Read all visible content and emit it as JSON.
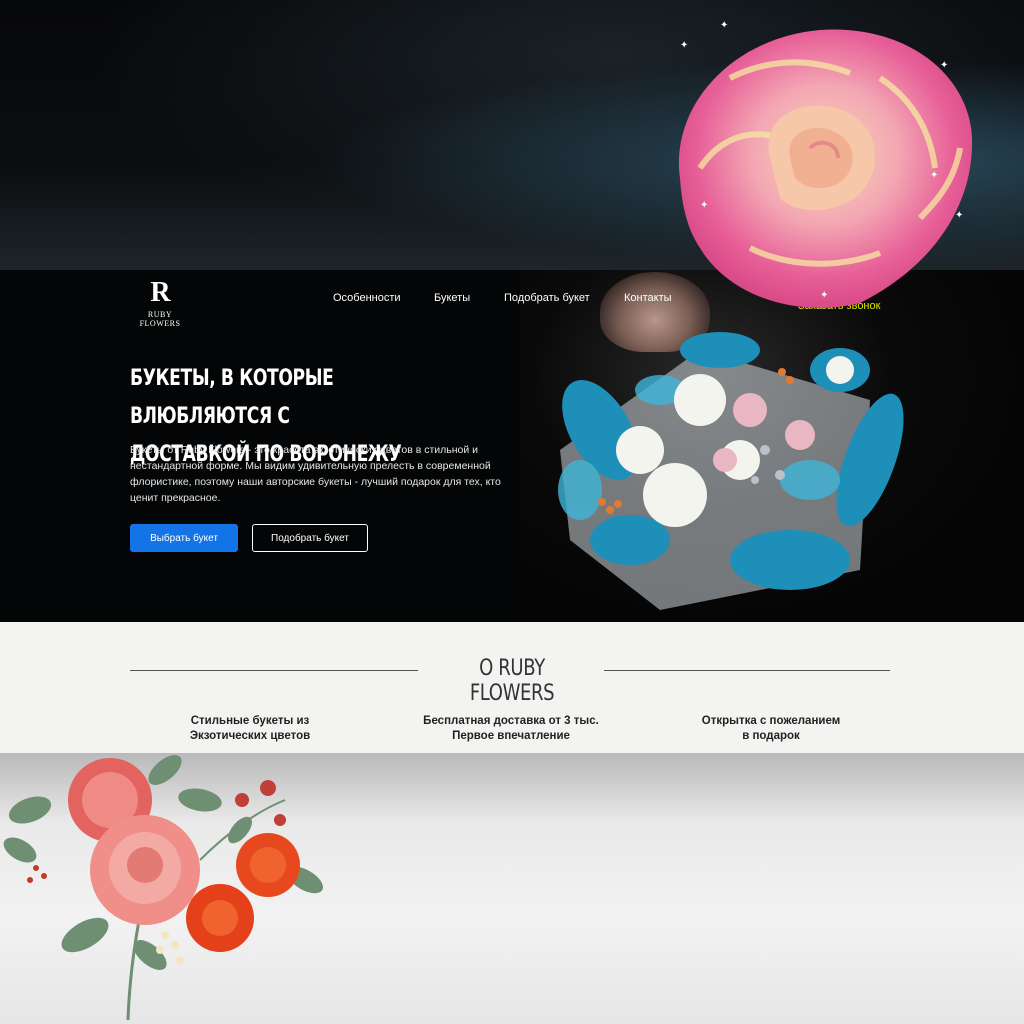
{
  "brand": {
    "logo_mark": "R",
    "logo_text": "RUBY FLOWERS"
  },
  "nav": {
    "items": [
      {
        "label": "Особенности"
      },
      {
        "label": "Букеты"
      },
      {
        "label": "Подобрать букет"
      },
      {
        "label": "Контакты"
      }
    ],
    "order_label": "Заказать звонок"
  },
  "hero": {
    "title_line1": "БУКЕТЫ, В КОТОРЫЕ ВЛЮБЛЯЮТСЯ С",
    "title_line2": "ДОСТАВКОЙ ПО ВОРОНЕЖУ",
    "description": "Букеты от Ruby Flowers - это красота экзотических цветов в стильной и нестандартной форме. Мы видим удивительную прелесть в современной флористике, поэтому наши авторские букеты - лучший подарок для тех, кто ценит прекрасное.",
    "primary_button": "Выбрать букет",
    "secondary_button": "Подобрать букет"
  },
  "about": {
    "title": "О RUBY FLOWERS",
    "features": [
      {
        "line1": "Стильные букеты из",
        "line2": "Экзотических цветов"
      },
      {
        "line1": "Бесплатная доставка от 3 тыс.",
        "line2": "Первое впечатление"
      },
      {
        "line1": "Открытка с пожеланием",
        "line2": "в подарок"
      }
    ]
  },
  "colors": {
    "accent": "#1473e6",
    "hero_bg": "#040506",
    "about_bg": "#f3f3f1",
    "order_link": "#d7e600"
  },
  "icons": [
    "pink-rose-icon",
    "floral-bouquet-icon",
    "sparkle-icon"
  ]
}
